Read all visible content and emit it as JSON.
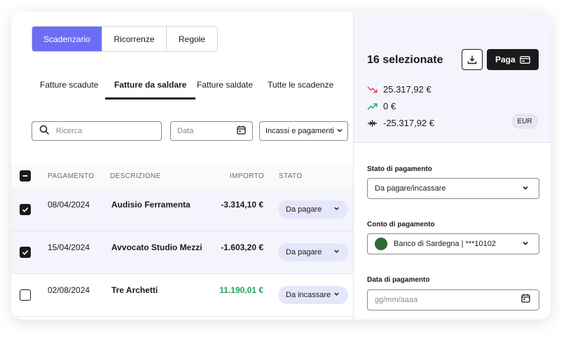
{
  "views": {
    "items": [
      "Scadenzario",
      "Ricorrenze",
      "Regole"
    ],
    "active_index": 0
  },
  "tabs": [
    "Fatture scadute",
    "Fatture da saldare",
    "Fatture saldate",
    "Tutte le scadenze"
  ],
  "filters": {
    "search_placeholder": "Ricerca",
    "date_placeholder": "Data",
    "type_selected": "Incassi e pagamenti"
  },
  "table": {
    "headers": {
      "payment": "PAGAMENTO",
      "description": "DESCRIZIONE",
      "amount": "IMPORTO",
      "status": "STATO"
    },
    "rows": [
      {
        "checked": true,
        "date": "08/04/2024",
        "description": "Audisio Ferramenta",
        "amount": "-3.314,10 €",
        "status": "Da pagare",
        "amount_color": "#1a1a1a"
      },
      {
        "checked": true,
        "date": "15/04/2024",
        "description": "Avvocato Studio Mezzi",
        "amount": "-1.603,20 €",
        "status": "Da pagare",
        "amount_color": "#1a1a1a"
      },
      {
        "checked": false,
        "date": "02/08/2024",
        "description": "Tre Archetti",
        "amount": "11.190,01 €",
        "status": "Da incassare",
        "amount_color": "#22a55a"
      }
    ]
  },
  "panel": {
    "selected_title": "16 selezionate",
    "download_icon": "download-icon",
    "pay_label": "Paga",
    "outgoing": "25.317,92 €",
    "incoming": "0 €",
    "balance": "-25.317,92 €",
    "currency": "EUR",
    "colors": {
      "outgoing": "#e5484d",
      "incoming": "#22a55a"
    },
    "payment_status_label": "Stato di pagamento",
    "payment_status_value": "Da pagare/incassare",
    "account_label": "Conto di pagamento",
    "account_value": "Banco di Sardegna | ***10102",
    "date_label": "Data di pagamento",
    "date_placeholder": "gg/mm/aaaa"
  },
  "colors": {
    "accent": "#6b6ef5",
    "selected_row": "#f4f4fd",
    "badge": "#e6e6fb"
  }
}
